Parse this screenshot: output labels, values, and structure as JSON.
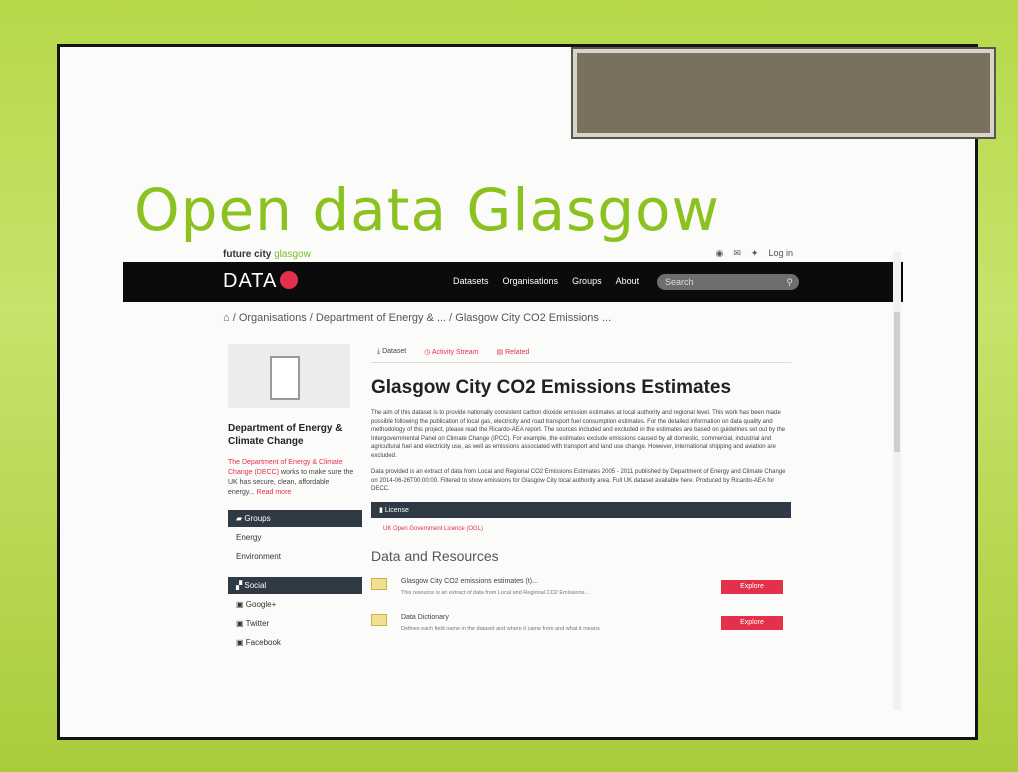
{
  "slide": {
    "title": "Open data Glasgow"
  },
  "site": {
    "future_city": "future city",
    "glasgow": "glasgow",
    "login": "Log in",
    "data_logo": "DATA",
    "nav": [
      "Datasets",
      "Organisations",
      "Groups",
      "About"
    ],
    "search_placeholder": "Search"
  },
  "breadcrumb": "/ Organisations / Department of Energy & ... / Glasgow City CO2 Emissions ...",
  "org": {
    "name": "Department of Energy & Climate Change",
    "desc_red": "The Department of Energy & Climate Change (DECC)",
    "desc": " works to make sure the UK has secure, clean, affordable energy...",
    "read_more": "Read more"
  },
  "sidebar": {
    "groups_label": "Groups",
    "groups": [
      "Energy",
      "Environment"
    ],
    "social_label": "Social",
    "social": [
      "Google+",
      "Twitter",
      "Facebook"
    ]
  },
  "tabs": [
    "Dataset",
    "Activity Stream",
    "Related"
  ],
  "dataset": {
    "title": "Glasgow City CO2 Emissions Estimates",
    "para1": "The aim of this dataset is to provide nationally consistent carbon dioxide emission estimates at local authority and regional level. This work has been made possible following the publication of local gas, electricity and road transport fuel consumption estimates. For the detailed information on data quality and methodology of this project, please read the Ricardo-AEA report. The sources included and excluded in the estimates are based on guidelines set out by the Intergovernmental Panel on Climate Change (IPCC). For example, the estimates exclude emissions caused by all domestic, commercial, industrial and agricultural fuel and electricity use, as well as emissions associated with transport and land use change. However, international shipping and aviation are excluded.",
    "para2": "Data provided is an extract of data from Local and Regional CO2 Emissions Estimates 2005 - 2011 published by Department of Energy and Climate Change on 2014-06-26T00:00:00. Filtered to show emissions for Glasgow City local authority area. Full UK dataset available here. Produced by Ricardo-AEA for DECC.",
    "license_label": "License",
    "license_link": "UK Open Government Licence (OGL)"
  },
  "resources": {
    "heading": "Data and Resources",
    "items": [
      {
        "title": "Glasgow City CO2 emissions estimates (t)...",
        "desc": "This resource is an extract of data from Local and Regional CO2 Emissions...",
        "button": "Explore"
      },
      {
        "title": "Data Dictionary",
        "desc": "Defines each field name in the dataset and where it came from and what it means",
        "button": "Explore"
      }
    ]
  }
}
